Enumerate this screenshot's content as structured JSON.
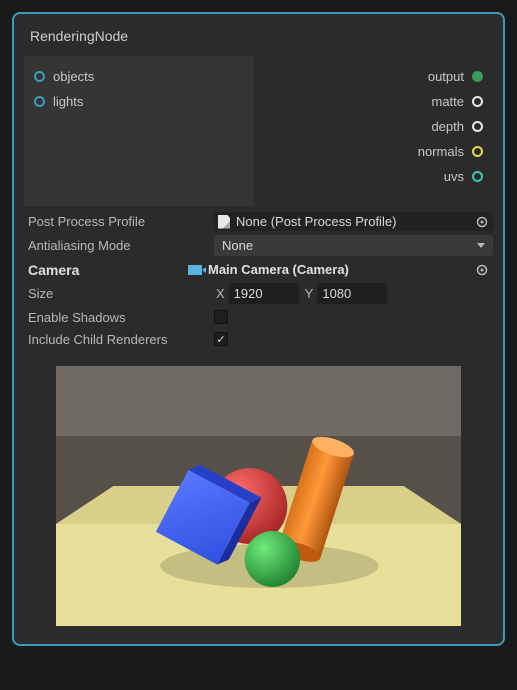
{
  "title": "RenderingNode",
  "inputs": [
    {
      "label": "objects",
      "color": "#3a9db8"
    },
    {
      "label": "lights",
      "color": "#3a9db8"
    }
  ],
  "outputs": [
    {
      "label": "output",
      "color": "#3a9e5a",
      "filled": true
    },
    {
      "label": "matte",
      "color": "#e8e8e8",
      "filled": false
    },
    {
      "label": "depth",
      "color": "#e8e8e8",
      "filled": false
    },
    {
      "label": "normals",
      "color": "#e8d850",
      "filled": false
    },
    {
      "label": "uvs",
      "color": "#3ac8b8",
      "filled": false
    }
  ],
  "props": {
    "post_process_label": "Post Process Profile",
    "post_process_value": "None (Post Process Profile)",
    "aa_label": "Antialiasing Mode",
    "aa_value": "None",
    "camera_label": "Camera",
    "camera_value": "Main Camera (Camera)",
    "size_label": "Size",
    "size_x_label": "X",
    "size_x": "1920",
    "size_y_label": "Y",
    "size_y": "1080",
    "shadows_label": "Enable Shadows",
    "shadows": false,
    "children_label": "Include Child Renderers",
    "children": true
  }
}
